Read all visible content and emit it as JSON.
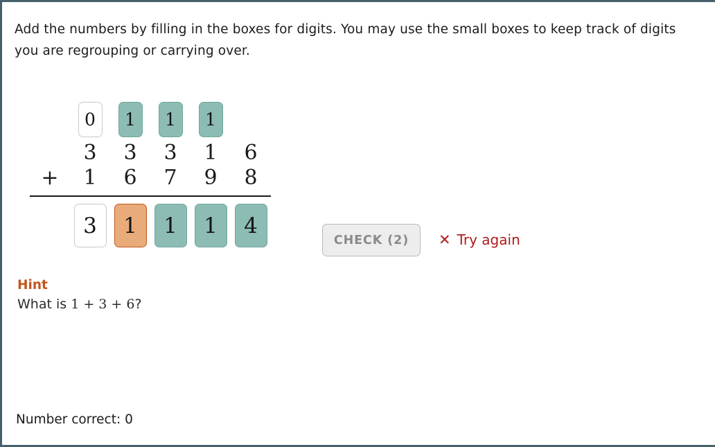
{
  "instructions": "Add the numbers by filling in the boxes for digits. You may use the small boxes to keep track of digits you are regrouping or carrying over.",
  "problem": {
    "operator": "+",
    "carry_row": [
      {
        "value": "0",
        "state": "empty"
      },
      {
        "value": "1",
        "state": "filled"
      },
      {
        "value": "1",
        "state": "filled"
      },
      {
        "value": "1",
        "state": "filled"
      }
    ],
    "addend_top": [
      "3",
      "3",
      "3",
      "1",
      "6"
    ],
    "addend_bottom": [
      "1",
      "6",
      "7",
      "9",
      "8"
    ],
    "answer_row": [
      {
        "value": "3",
        "state": "empty"
      },
      {
        "value": "1",
        "state": "selected"
      },
      {
        "value": "1",
        "state": "filled"
      },
      {
        "value": "1",
        "state": "filled"
      },
      {
        "value": "4",
        "state": "filled"
      }
    ]
  },
  "controls": {
    "check_label": "CHECK (2)",
    "status_icon": "✕",
    "status_text": "Try again"
  },
  "hint": {
    "title": "Hint",
    "question_prefix": "What is ",
    "question_math": "1 + 3 + 6",
    "question_suffix": "?"
  },
  "footer": {
    "score_label": "Number correct: 0"
  },
  "colors": {
    "frame": "#46606b",
    "filled_box": "#8cbcb4",
    "selected_box": "#e9ab79",
    "selected_border": "#c2561d",
    "hint_accent": "#c2561d",
    "error_text": "#b01b1b"
  }
}
